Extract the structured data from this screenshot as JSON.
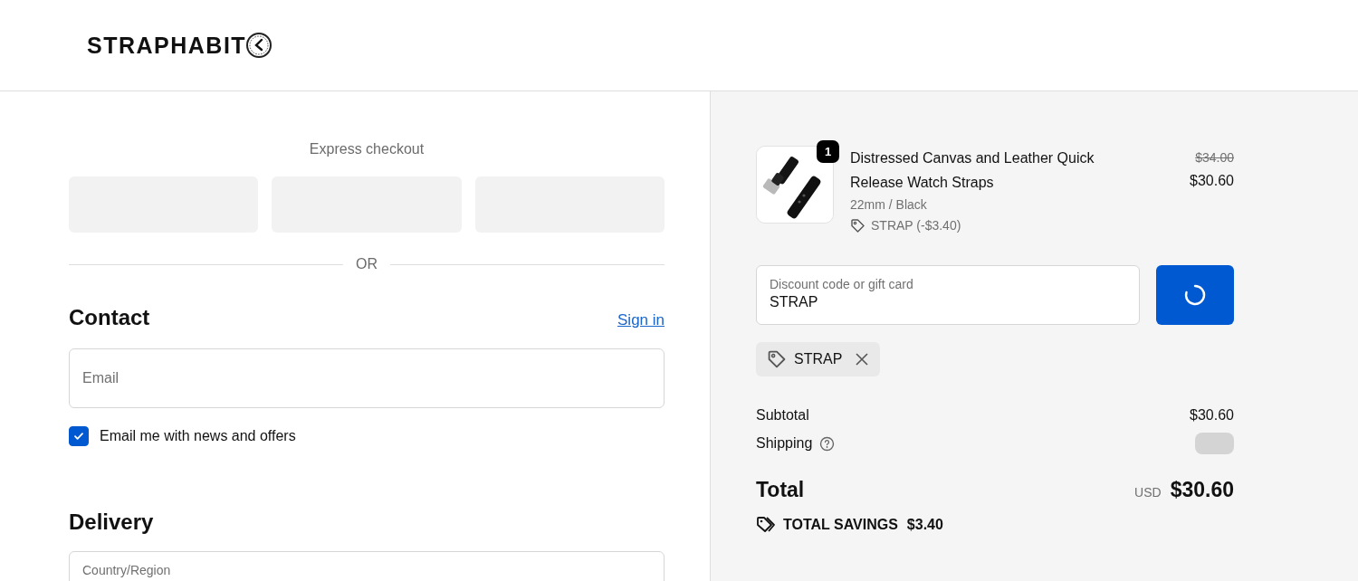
{
  "header": {
    "logo": "STRAPHABIT"
  },
  "express_checkout": {
    "title": "Express checkout",
    "payment_buttons": [
      {
        "kind": "skeleton"
      },
      {
        "kind": "skeleton"
      },
      {
        "kind": "skeleton"
      }
    ],
    "divider_label": "OR"
  },
  "contact": {
    "heading": "Contact",
    "sign_in": "Sign in",
    "email": {
      "placeholder": "Email"
    },
    "newsletter": {
      "label": "Email me with news and offers",
      "checked": true
    }
  },
  "delivery": {
    "heading": "Delivery",
    "country_field": {
      "label": "Country/Region"
    }
  },
  "summary": {
    "items": [
      {
        "quantity": "1",
        "name": "Distressed Canvas and Leather Quick Release Watch Straps",
        "variant": "22mm / Black",
        "discount": "STRAP (-$3.40)",
        "original_price": "$34.00",
        "price": "$30.60"
      }
    ],
    "discount_field": {
      "label": "Discount code or gift card",
      "value": "STRAP"
    },
    "apply_button": {
      "loading": true
    },
    "applied_codes": [
      {
        "code": "STRAP"
      }
    ],
    "subtotal": {
      "label": "Subtotal",
      "value": "$30.60"
    },
    "shipping": {
      "label": "Shipping",
      "loading": true
    },
    "total": {
      "label": "Total",
      "currency": "USD",
      "value": "$30.60"
    },
    "savings": {
      "label": "TOTAL SAVINGS",
      "value": "$3.40"
    }
  }
}
